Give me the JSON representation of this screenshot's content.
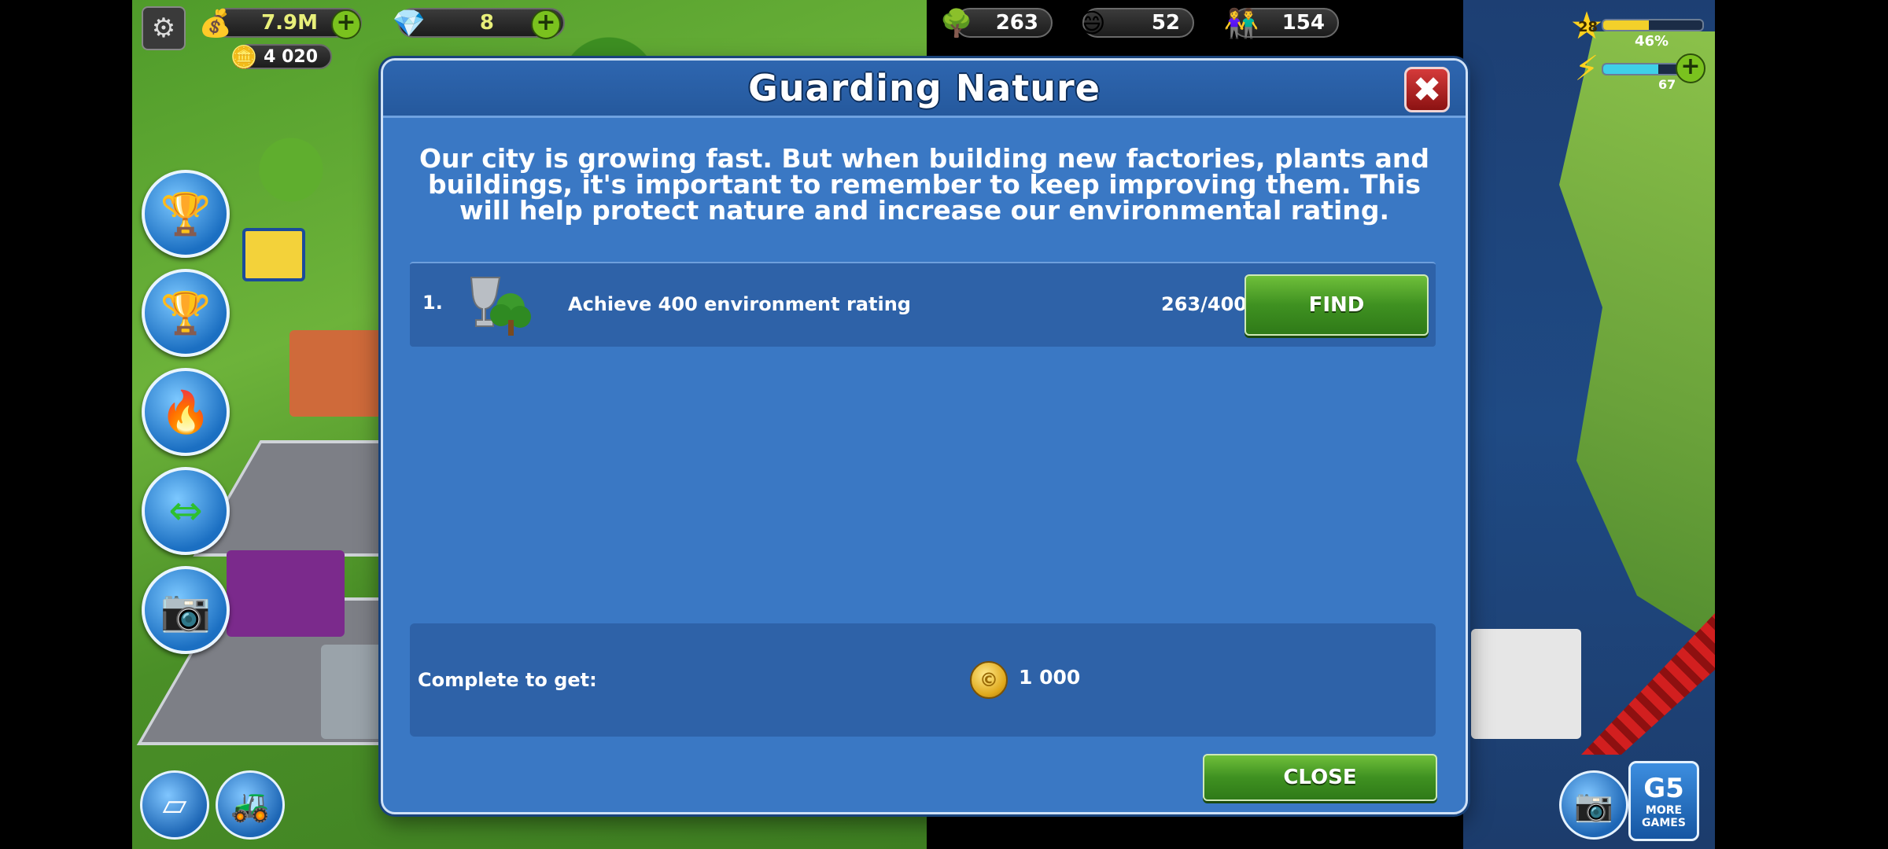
{
  "hud": {
    "money": "7.9M",
    "gems": "8",
    "gold_coins": "4 020",
    "environment": "263",
    "happiness": "52",
    "population": "154",
    "level": "28",
    "level_progress_text": "46%",
    "level_progress": 0.46,
    "energy_value": "67",
    "energy_progress": 0.7
  },
  "icons": {
    "settings": "gear-icon",
    "money": "coins-icon",
    "gems": "diamond-icon",
    "gold": "gold-icon",
    "environment": "tree-icon",
    "happiness": "smiley-icon",
    "population": "people-icon",
    "level": "star-icon",
    "energy": "lightning-icon"
  },
  "dialog": {
    "title": "Guarding Nature",
    "description": "Our city is growing fast. But when building new factories, plants and buildings, it's important to remember to keep improving them. This will help protect nature and increase our environmental rating.",
    "tasks": [
      {
        "number": "1.",
        "text": "Achieve 400 environment rating",
        "progress": "263/400",
        "button": "FIND"
      }
    ],
    "reward_label": "Complete to get:",
    "reward_value": "1 000",
    "close_label": "CLOSE"
  },
  "more_games": "MORE GAMES"
}
